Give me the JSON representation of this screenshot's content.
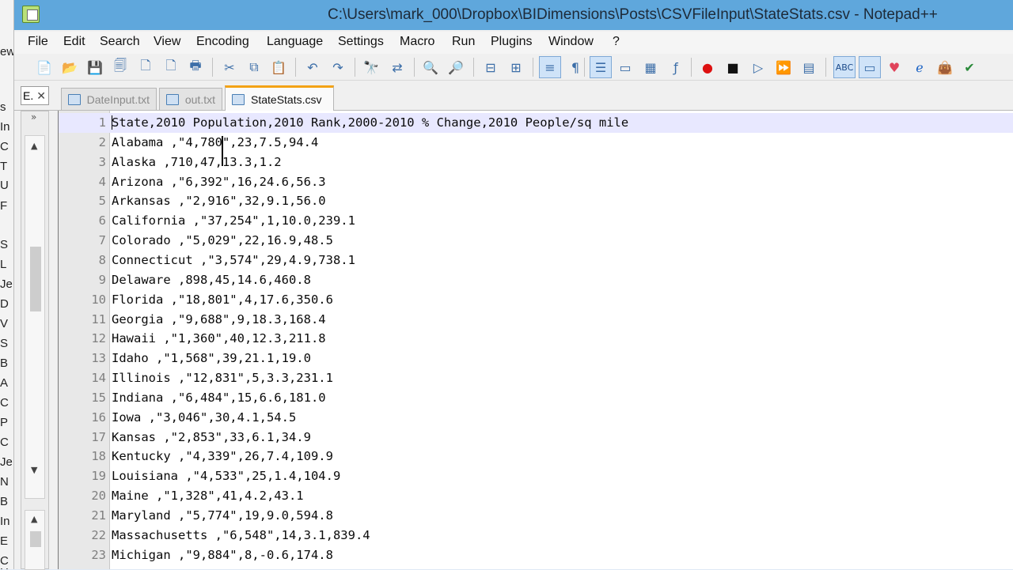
{
  "title": "C:\\Users\\mark_000\\Dropbox\\BIDimensions\\Posts\\CSVFileInput\\StateStats.csv - Notepad++",
  "menu": [
    "File",
    "Edit",
    "Search",
    "View",
    "Encoding",
    "Language",
    "Settings",
    "Macro",
    "Run",
    "Plugins",
    "Window",
    "?"
  ],
  "panel_tab": {
    "label": "E.",
    "close": "✕"
  },
  "tabs": [
    {
      "label": "DateInput.txt",
      "active": false
    },
    {
      "label": "out.txt",
      "active": false
    },
    {
      "label": "StateStats.csv",
      "active": true
    }
  ],
  "left_strip_letters": [
    "ew",
    "s",
    "In",
    "C",
    "T",
    "U",
    "F",
    "",
    "S",
    "L",
    "Je",
    "D",
    "V",
    "S",
    "B",
    "A",
    "C",
    "P",
    "C",
    "Je",
    "N",
    "B",
    "In",
    "E",
    "C",
    "H"
  ],
  "lines": [
    {
      "n": "1",
      "text": "State,2010 Population,2010 Rank,2000-2010 % Change,2010 People/sq mile"
    },
    {
      "n": "2",
      "text": "Alabama ,\"4,780\",23,7.5,94.4"
    },
    {
      "n": "3",
      "text": "Alaska ,710,47,13.3,1.2"
    },
    {
      "n": "4",
      "text": "Arizona ,\"6,392\",16,24.6,56.3"
    },
    {
      "n": "5",
      "text": "Arkansas ,\"2,916\",32,9.1,56.0"
    },
    {
      "n": "6",
      "text": "California ,\"37,254\",1,10.0,239.1"
    },
    {
      "n": "7",
      "text": "Colorado ,\"5,029\",22,16.9,48.5"
    },
    {
      "n": "8",
      "text": "Connecticut ,\"3,574\",29,4.9,738.1"
    },
    {
      "n": "9",
      "text": "Delaware ,898,45,14.6,460.8"
    },
    {
      "n": "10",
      "text": "Florida ,\"18,801\",4,17.6,350.6"
    },
    {
      "n": "11",
      "text": "Georgia ,\"9,688\",9,18.3,168.4"
    },
    {
      "n": "12",
      "text": "Hawaii ,\"1,360\",40,12.3,211.8"
    },
    {
      "n": "13",
      "text": "Idaho ,\"1,568\",39,21.1,19.0"
    },
    {
      "n": "14",
      "text": "Illinois ,\"12,831\",5,3.3,231.1"
    },
    {
      "n": "15",
      "text": "Indiana ,\"6,484\",15,6.6,181.0"
    },
    {
      "n": "16",
      "text": "Iowa ,\"3,046\",30,4.1,54.5"
    },
    {
      "n": "17",
      "text": "Kansas ,\"2,853\",33,6.1,34.9"
    },
    {
      "n": "18",
      "text": "Kentucky ,\"4,339\",26,7.4,109.9"
    },
    {
      "n": "19",
      "text": "Louisiana ,\"4,533\",25,1.4,104.9"
    },
    {
      "n": "20",
      "text": "Maine ,\"1,328\",41,4.2,43.1"
    },
    {
      "n": "21",
      "text": "Maryland ,\"5,774\",19,9.0,594.8"
    },
    {
      "n": "22",
      "text": "Massachusetts ,\"6,548\",14,3.1,839.4"
    },
    {
      "n": "23",
      "text": "Michigan ,\"9,884\",8,-0.6,174.8"
    }
  ],
  "colors": {
    "titlebar": "#5fa7dc",
    "active_tab_accent": "#f3a316",
    "current_line": "#e8e8ff"
  }
}
